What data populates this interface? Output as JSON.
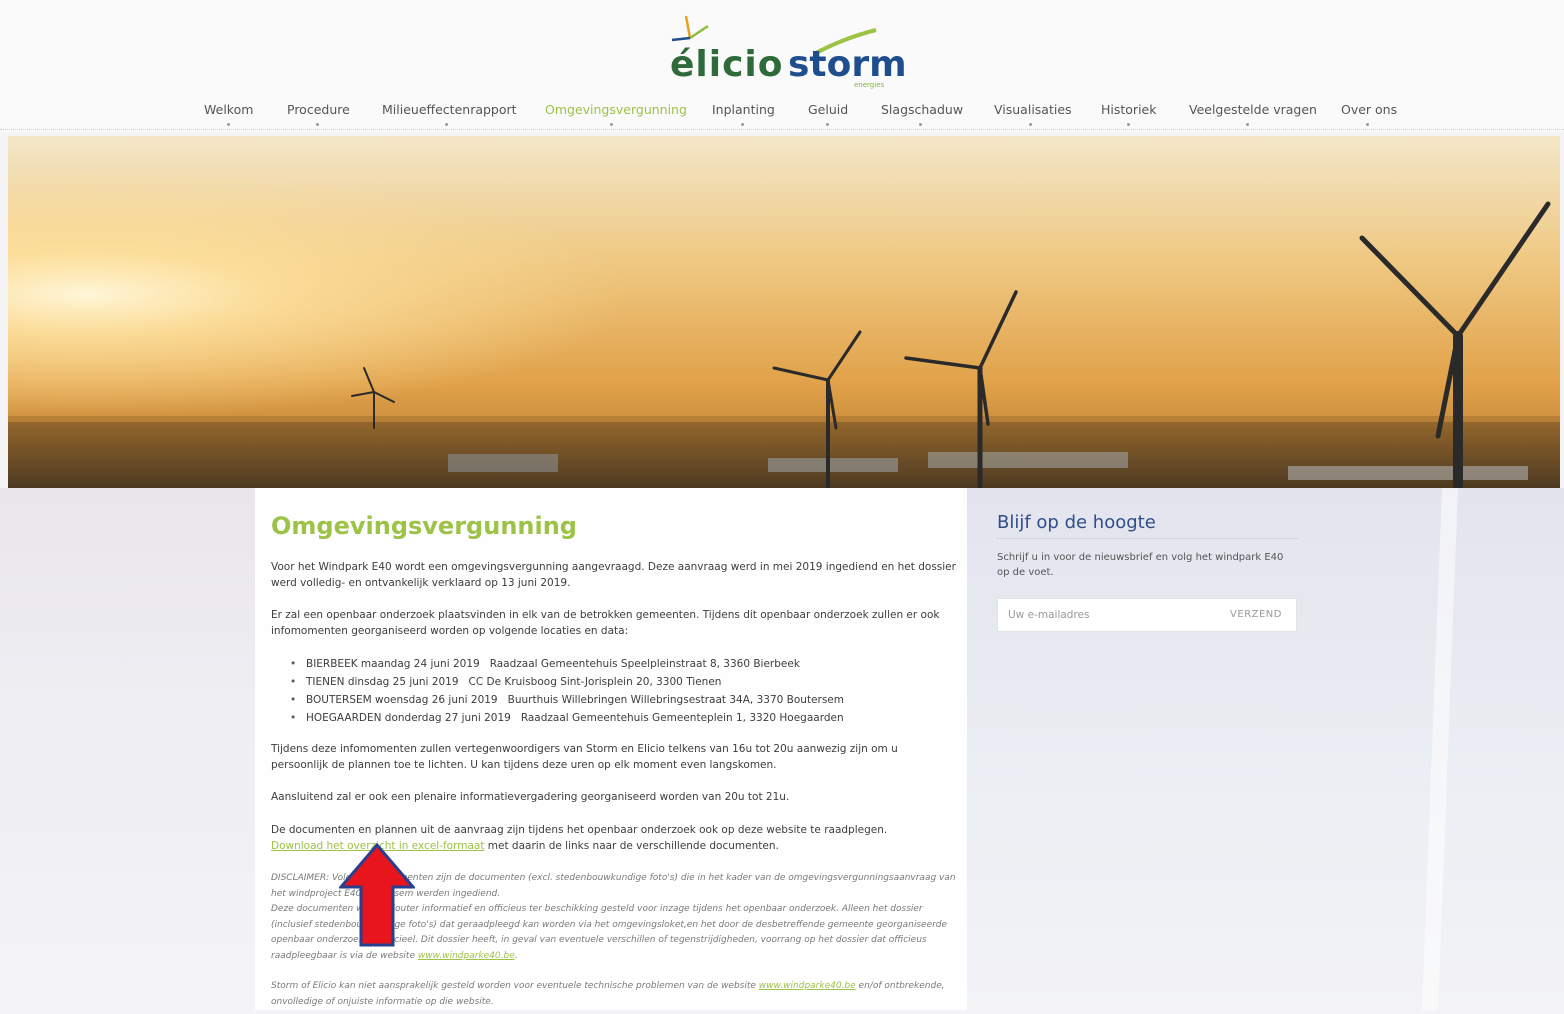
{
  "brand": {
    "logo_left": "élicio",
    "logo_right": "storm",
    "logo_sub": "energies"
  },
  "nav": {
    "items": [
      {
        "label": "Welkom"
      },
      {
        "label": "Procedure"
      },
      {
        "label": "Milieueffectenrapport"
      },
      {
        "label": "Omgevingsvergunning",
        "active": true
      },
      {
        "label": "Inplanting"
      },
      {
        "label": "Geluid"
      },
      {
        "label": "Slagschaduw"
      },
      {
        "label": "Visualisaties"
      },
      {
        "label": "Historiek"
      },
      {
        "label": "Veelgestelde vragen"
      },
      {
        "label": "Over ons"
      }
    ]
  },
  "main": {
    "title": "Omgevingsvergunning",
    "intro": "Voor het Windpark E40 wordt een omgevingsvergunning aangevraagd. Deze aanvraag werd in mei 2019 ingediend en het dossier werd volledig- en ontvankelijk verklaard op 13 juni 2019.",
    "investigation": "Er zal een openbaar onderzoek plaatsvinden in elk van de betrokken gemeenten. Tijdens dit openbaar onderzoek zullen er ook infomomenten georganiseerd worden op volgende locaties en data:",
    "sessions": [
      {
        "when": "BIERBEEK maandag 24 juni 2019",
        "where": "Raadzaal Gemeentehuis Speelpleinstraat 8, 3360 Bierbeek"
      },
      {
        "when": "TIENEN dinsdag 25 juni 2019",
        "where": "CC De Kruisboog Sint-Jorisplein 20, 3300 Tienen"
      },
      {
        "when": "BOUTERSEM woensdag 26 juni 2019",
        "where": "Buurthuis Willebringen  Willebringsestraat 34A, 3370 Boutersem"
      },
      {
        "when": "HOEGAARDEN donderdag 27 juni 2019",
        "where": "Raadzaal Gemeentehuis  Gemeenteplein 1, 3320 Hoegaarden"
      }
    ],
    "representatives": "Tijdens deze infomomenten zullen vertegenwoordigers van Storm en Elicio telkens van 16u tot 20u aanwezig zijn om u persoonlijk de plannen toe te lichten. U kan tijdens deze uren op elk moment even langskomen.",
    "plenary": "Aansluitend zal er ook een plenaire informatievergadering georganiseerd worden van 20u tot 21u.",
    "documents": "De documenten en plannen uit de aanvraag zijn tijdens het openbaar onderzoek ook op deze website te raadplegen.",
    "download_link": "Download het overzicht in excel-formaat",
    "download_suffix": " met daarin de links naar de verschillende documenten.",
    "disclaimer_1": "DISCLAIMER: Volgende documenten zijn de documenten (excl. stedenbouwkundige foto's) die in het kader van de omgevingsvergunningsaanvraag van het windproject E40 Boutersem werden ingediend.",
    "disclaimer_2": "Deze documenten worden louter informatief en officieus ter beschikking gesteld voor inzage tijdens het openbaar onderzoek.  Alleen het dossier (inclusief stedenbouwkundige foto's) dat geraadpleegd kan worden via het omgevingsloket,en het door de desbetreffende gemeente georganiseerde openbaar onderzoek, is officieel. Dit dossier heeft, in geval van eventuele verschillen of tegenstrijdigheden, voorrang op het dossier dat officieus raadpleegbaar is via de website ",
    "disclaimer_link": "www.windparke40.be",
    "disclaimer_end": ".",
    "liability_1": "Storm of Elicio kan niet aansprakelijk gesteld worden voor eventuele technische problemen van de website ",
    "liability_link": "www.windparke40.be",
    "liability_2": " en/of ontbrekende, onvolledige of onjuiste informatie op die website."
  },
  "sidebar": {
    "title": "Blijf op de hoogte",
    "text": "Schrijf u in voor de nieuwsbrief en volg het windpark E40 op de voet.",
    "email_placeholder": "Uw e-mailadres",
    "submit_label": "VERZEND"
  },
  "colors": {
    "accent_green": "#9cc246",
    "title_blue": "#2f4f8a",
    "arrow_red": "#e8151c"
  }
}
